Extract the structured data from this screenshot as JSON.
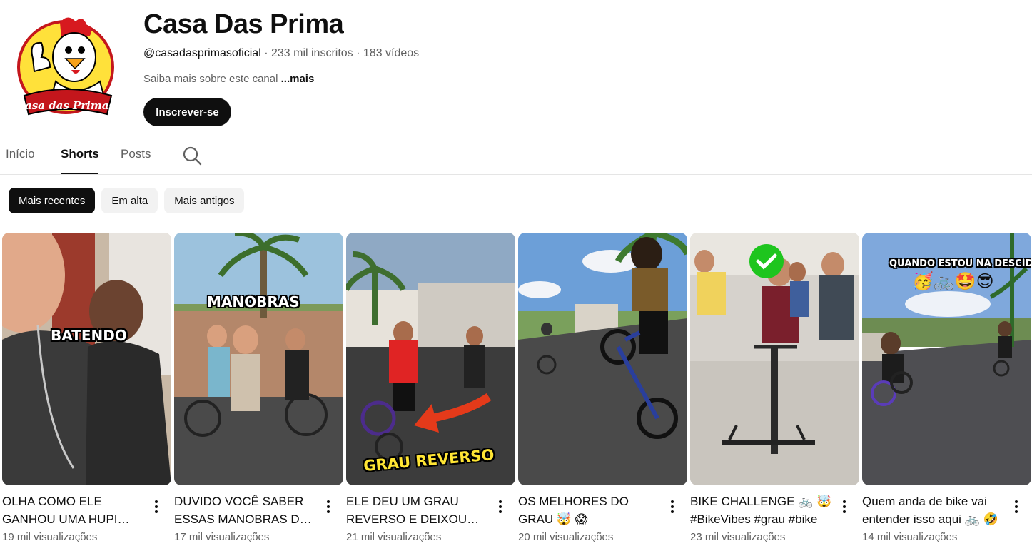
{
  "channel": {
    "name": "Casa Das Prima",
    "handle": "@casadasprimasoficial",
    "subscribers": "233 mil inscritos",
    "separator": " · ",
    "videos": "183 vídeos",
    "about": "Saiba mais sobre este canal",
    "about_more": "...mais",
    "subscribe_label": "Inscrever-se",
    "logo_text": "Casa das Primas"
  },
  "tabs": [
    {
      "label": "Início",
      "active": false
    },
    {
      "label": "Shorts",
      "active": true
    },
    {
      "label": "Posts",
      "active": false
    }
  ],
  "tab_search_icon": "search-icon",
  "chips": [
    {
      "label": "Mais recentes",
      "active": true
    },
    {
      "label": "Em alta",
      "active": false
    },
    {
      "label": "Mais antigos",
      "active": false
    }
  ],
  "shorts": [
    {
      "title": "OLHA COMO ELE GANHOU UMA HUPI BIKE",
      "views": "19 mil visualizações",
      "overlay": "BATENDO"
    },
    {
      "title": "DUVIDO VOCÊ SABER ESSAS MANOBRAS DE BIKE",
      "views": "17 mil visualizações",
      "overlay": "MANOBRAS"
    },
    {
      "title": "ELE DEU UM GRAU REVERSO E DEIXOU TODO MUNDO",
      "views": "21 mil visualizações",
      "overlay": "GRAU REVERSO"
    },
    {
      "title": "OS MELHORES DO GRAU 🤯 😱",
      "views": "20 mil visualizações",
      "overlay": ""
    },
    {
      "title": "BIKE CHALLENGE 🚲 🤯 #BikeVibes #grau #bike",
      "views": "23 mil visualizações",
      "overlay": ""
    },
    {
      "title": "Quem anda de bike vai entender isso aqui 🚲 🤣",
      "views": "14 mil visualizações",
      "overlay": "QUANDO ESTOU NA DESCIDA",
      "overlay_emoji": "🥳🚲🤩😎"
    }
  ],
  "colors": {
    "text_primary": "#0f0f0f",
    "text_secondary": "#606060",
    "chip_bg": "#f2f2f2",
    "accent_dark": "#0f0f0f"
  }
}
